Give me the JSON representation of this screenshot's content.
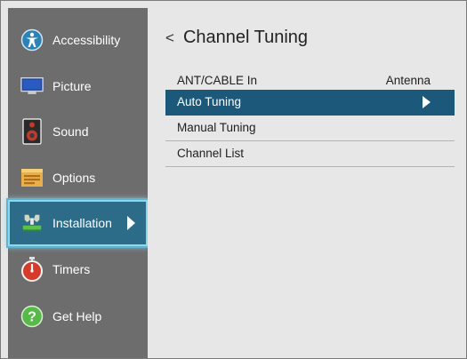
{
  "sidebar": {
    "items": [
      {
        "label": "Accessibility",
        "icon": "accessibility-icon"
      },
      {
        "label": "Picture",
        "icon": "monitor-icon"
      },
      {
        "label": "Sound",
        "icon": "speaker-icon"
      },
      {
        "label": "Options",
        "icon": "options-icon"
      },
      {
        "label": "Installation",
        "icon": "installation-icon",
        "selected": true
      },
      {
        "label": "Timers",
        "icon": "stopwatch-icon"
      },
      {
        "label": "Get Help",
        "icon": "help-icon"
      }
    ]
  },
  "main": {
    "back_symbol": "<",
    "title": "Channel Tuning",
    "rows": [
      {
        "label": "ANT/CABLE In",
        "value": "Antenna"
      },
      {
        "label": "Auto Tuning",
        "selected": true
      },
      {
        "label": "Manual Tuning"
      },
      {
        "label": "Channel List"
      }
    ]
  },
  "colors": {
    "sidebar_bg": "#6d6d6d",
    "panel_bg": "#e7e7e7",
    "selected_row": "#1b587a",
    "selected_sidebar_glow": "#8fd6ea"
  }
}
